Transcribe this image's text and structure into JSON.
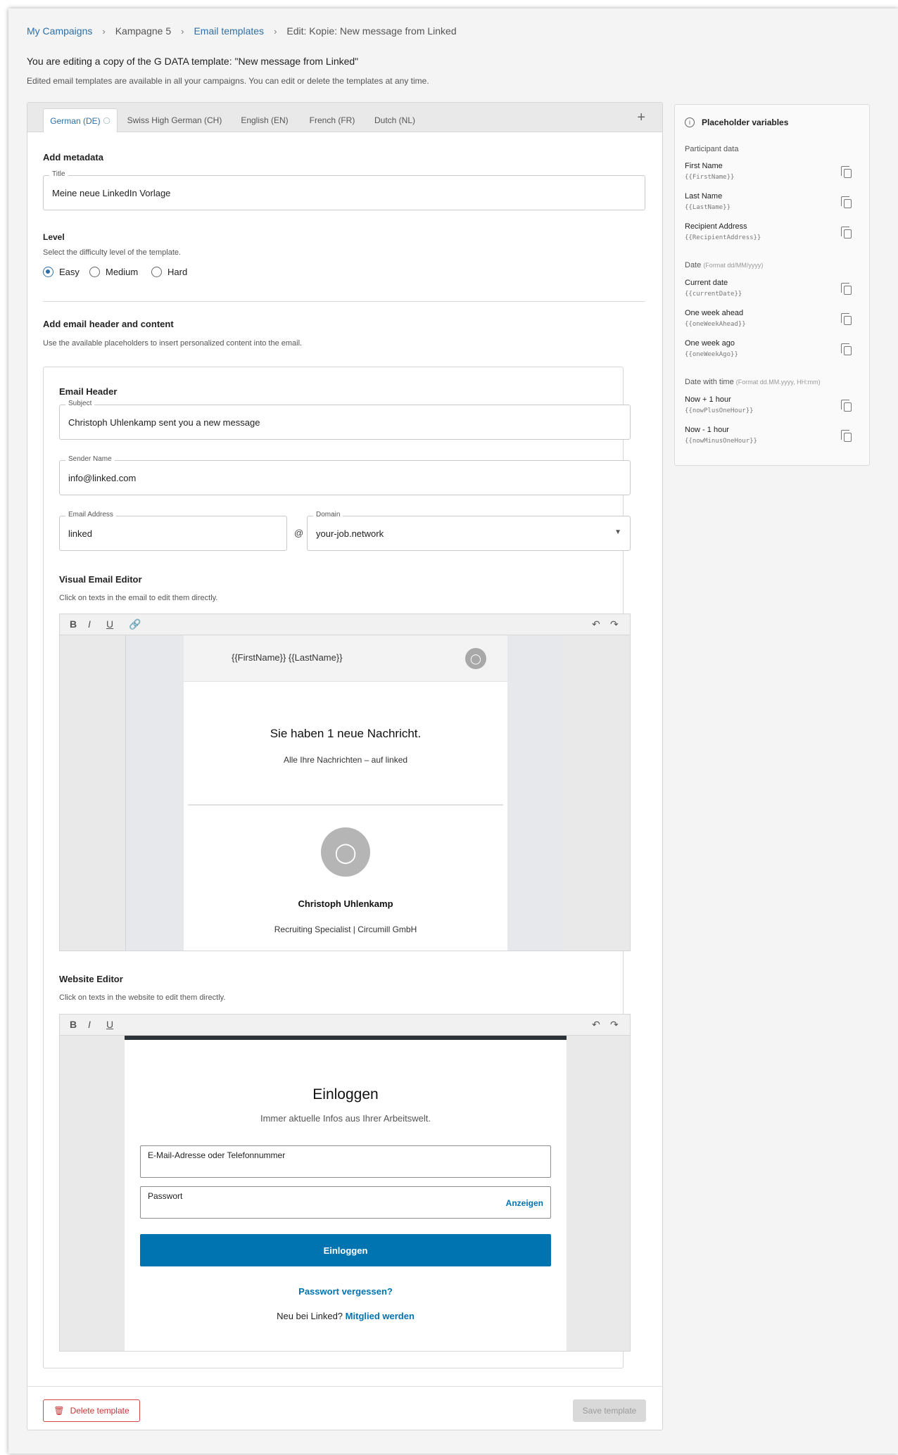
{
  "breadcrumb": {
    "items": [
      "My Campaigns",
      "Kampagne 5",
      "Email templates",
      "Edit: Kopie: New message from Linked"
    ]
  },
  "intro": {
    "title": "You are editing a copy of the G DATA template: \"New message from Linked\"",
    "subtitle": "Edited email templates are available in all your campaigns. You can edit or delete the templates at any time."
  },
  "tabs": [
    "German (DE)",
    "Swiss High German (CH)",
    "English (EN)",
    "French (FR)",
    "Dutch (NL)"
  ],
  "tab_add": "+",
  "metadata": {
    "heading": "Add metadata",
    "title_label": "Title",
    "title_value": "Meine neue LinkedIn Vorlage",
    "level_heading": "Level",
    "level_sub": "Select the difficulty level of the template.",
    "levels": [
      "Easy",
      "Medium",
      "Hard"
    ],
    "selected_level": "Easy"
  },
  "content": {
    "heading": "Add email header and content",
    "sub": "Use the available placeholders to insert personalized content into the email."
  },
  "email_header": {
    "heading": "Email Header",
    "subject_label": "Subject",
    "subject_value": "Christoph Uhlenkamp sent you a new message",
    "sender_label": "Sender Name",
    "sender_value": "info@linked.com",
    "address_label": "Email Address",
    "address_value": "linked",
    "at_sign": "@",
    "domain_label": "Domain",
    "domain_value": "your-job.network"
  },
  "visual_editor": {
    "heading": "Visual Email Editor",
    "sub": "Click on texts in the email to edit them directly.",
    "toolbar": [
      "B",
      "I",
      "U"
    ],
    "email": {
      "recipient": "{{FirstName}} {{LastName}}",
      "headline": "Sie haben 1 neue Nachricht.",
      "subline": "Alle Ihre Nachrichten – auf linked",
      "sender_name": "Christoph Uhlenkamp",
      "sender_role": "Recruiting Specialist | Circumill GmbH"
    }
  },
  "website_editor": {
    "heading": "Website Editor",
    "sub": "Click on texts in the website to edit them directly.",
    "toolbar": [
      "B",
      "I",
      "U"
    ],
    "site": {
      "title": "Einloggen",
      "subtitle": "Immer aktuelle Infos aus Ihrer Arbeitswelt.",
      "email_placeholder": "E-Mail-Adresse oder Telefonnummer",
      "password_placeholder": "Passwort",
      "show_label": "Anzeigen",
      "login_button": "Einloggen",
      "forgot": "Passwort vergessen?",
      "new_prefix": "Neu bei Linked?",
      "join": "Mitglied werden"
    }
  },
  "buttons": {
    "delete": "Delete template",
    "save": "Save template"
  },
  "placeholders": {
    "title": "Placeholder variables",
    "groups": [
      {
        "name": "Participant data",
        "format": "",
        "items": [
          {
            "label": "First Name",
            "code": "{{FirstName}}"
          },
          {
            "label": "Last Name",
            "code": "{{LastName}}"
          },
          {
            "label": "Recipient Address",
            "code": "{{RecipientAddress}}"
          }
        ]
      },
      {
        "name": "Date",
        "format": "(Format dd/MM/yyyy)",
        "items": [
          {
            "label": "Current date",
            "code": "{{currentDate}}"
          },
          {
            "label": "One week ahead",
            "code": "{{oneWeekAhead}}"
          },
          {
            "label": "One week ago",
            "code": "{{oneWeekAgo}}"
          }
        ]
      },
      {
        "name": "Date with time",
        "format": "(Format dd.MM.yyyy, HH:mm)",
        "items": [
          {
            "label": "Now + 1 hour",
            "code": "{{nowPlusOneHour}}"
          },
          {
            "label": "Now - 1 hour",
            "code": "{{nowMinusOneHour}}"
          }
        ]
      }
    ]
  },
  "colors": {
    "accent": "#2f6fa6",
    "primary_button": "#0073b1",
    "danger": "#d64545"
  }
}
